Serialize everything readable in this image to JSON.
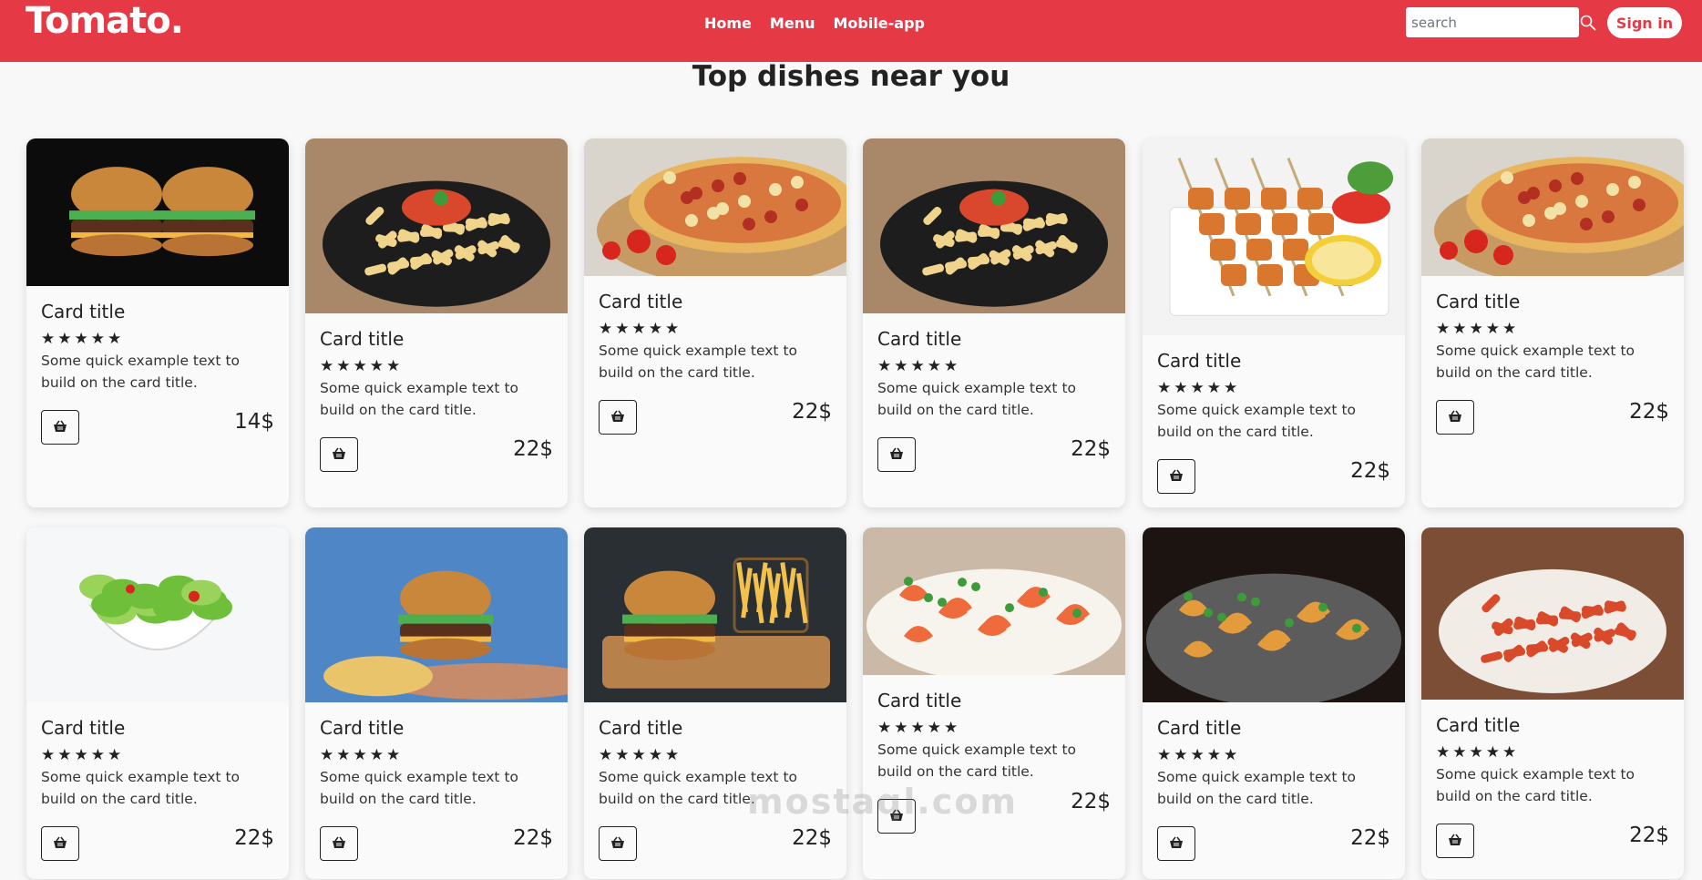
{
  "navbar": {
    "brand": "Tomato.",
    "links": [
      "Home",
      "Menu",
      "Mobile-app"
    ],
    "search_placeholder": "search",
    "signin_label": "Sign in"
  },
  "heading": "Top dishes near you",
  "colors": {
    "brand": "#e63946",
    "card_bg": "#fafafa"
  },
  "cards": [
    {
      "dish": "burger",
      "title": "Card title",
      "stars": "★★★★★",
      "text": "Some quick example text to build on the card title.",
      "price": "14$",
      "icon": "basket-icon"
    },
    {
      "dish": "pasta",
      "title": "Card title",
      "stars": "★★★★★",
      "text": "Some quick example text to build on the card title.",
      "price": "22$",
      "icon": "basket-icon"
    },
    {
      "dish": "pizza",
      "title": "Card title",
      "stars": "★★★★★",
      "text": "Some quick example text to build on the card title.",
      "price": "22$",
      "icon": "basket-icon"
    },
    {
      "dish": "pasta",
      "title": "Card title",
      "stars": "★★★★★",
      "text": "Some quick example text to build on the card title.",
      "price": "22$",
      "icon": "basket-icon"
    },
    {
      "dish": "kebab",
      "title": "Card title",
      "stars": "★★★★★",
      "text": "Some quick example text to build on the card title.",
      "price": "22$",
      "icon": "basket-icon"
    },
    {
      "dish": "pizza",
      "title": "Card title",
      "stars": "★★★★★",
      "text": "Some quick example text to build on the card title.",
      "price": "22$",
      "icon": "basket-icon"
    },
    {
      "dish": "salad",
      "title": "Card title",
      "stars": "★★★★★",
      "text": "Some quick example text to build on the card title.",
      "price": "22$",
      "icon": "basket-icon"
    },
    {
      "dish": "burger-hand",
      "title": "Card title",
      "stars": "★★★★★",
      "text": "Some quick example text to build on the card title.",
      "price": "22$",
      "icon": "basket-icon"
    },
    {
      "dish": "burger-fries",
      "title": "Card title",
      "stars": "★★★★★",
      "text": "Some quick example text to build on the card title.",
      "price": "22$",
      "icon": "basket-icon"
    },
    {
      "dish": "shrimp-salad",
      "title": "Card title",
      "stars": "★★★★★",
      "text": "Some quick example text to build on the card title.",
      "price": "22$",
      "icon": "basket-icon"
    },
    {
      "dish": "fried-shrimp",
      "title": "Card title",
      "stars": "★★★★★",
      "text": "Some quick example text to build on the card title.",
      "price": "22$",
      "icon": "basket-icon"
    },
    {
      "dish": "penne",
      "title": "Card title",
      "stars": "★★★★★",
      "text": "Some quick example text to build on the card title.",
      "price": "22$",
      "icon": "basket-icon"
    }
  ],
  "watermark": "mostaql.com"
}
